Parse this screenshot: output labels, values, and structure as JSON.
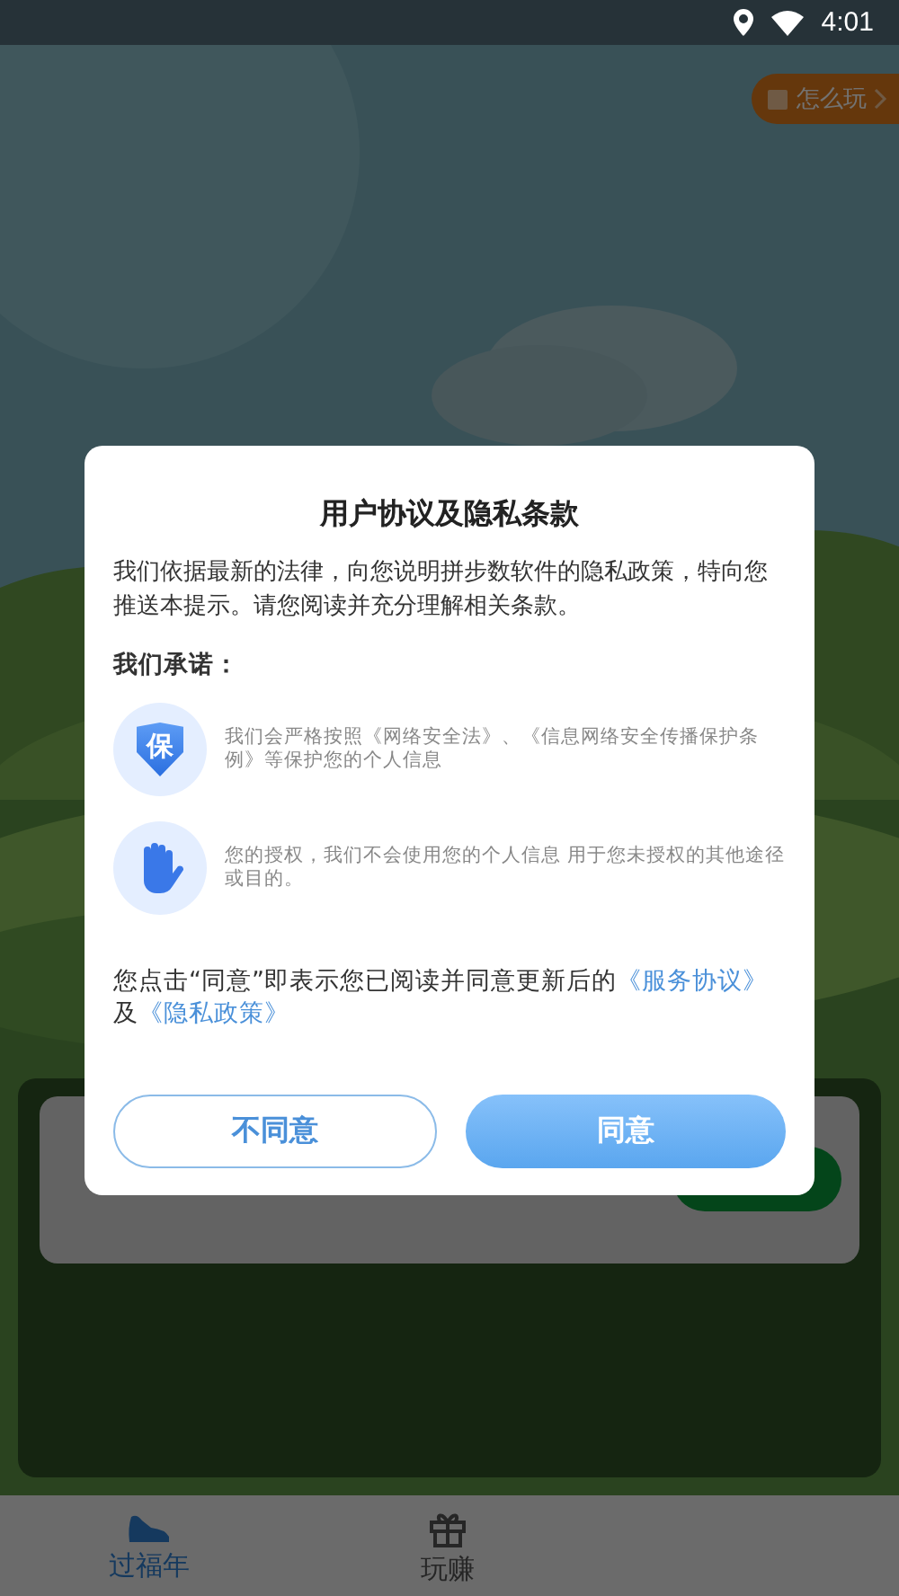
{
  "status_bar": {
    "time": "4:01"
  },
  "help_button": {
    "label": "怎么玩"
  },
  "dialog": {
    "title": "用户协议及隐私条款",
    "intro": "我们依据最新的法律，向您说明拼步数软件的隐私政策，特向您推送本提示。请您阅读并充分理解相关条款。",
    "promise_heading": "我们承诺：",
    "promises": [
      {
        "kind": "shield",
        "icon_text": "保",
        "text": "我们会严格按照《网络安全法》、《信息网络安全传播保护条例》等保护您的个人信息"
      },
      {
        "kind": "hand",
        "text": "您的授权，我们不会使用您的个人信息 用于您未授权的其他途径或目的。"
      }
    ],
    "consent": {
      "text": "您点击“同意”即表示您已阅读并同意更新后的",
      "links": [
        "《服务协议》",
        "《隐私政策》"
      ],
      "joiner": "及"
    },
    "buttons": [
      {
        "label": "不同意",
        "kind": "secondary"
      },
      {
        "label": "同意",
        "kind": "primary"
      }
    ]
  },
  "tabs": [
    {
      "label": "过福年",
      "selected": true,
      "kind": "shoe"
    },
    {
      "label": "玩赚",
      "selected": false,
      "kind": "gift"
    }
  ]
}
